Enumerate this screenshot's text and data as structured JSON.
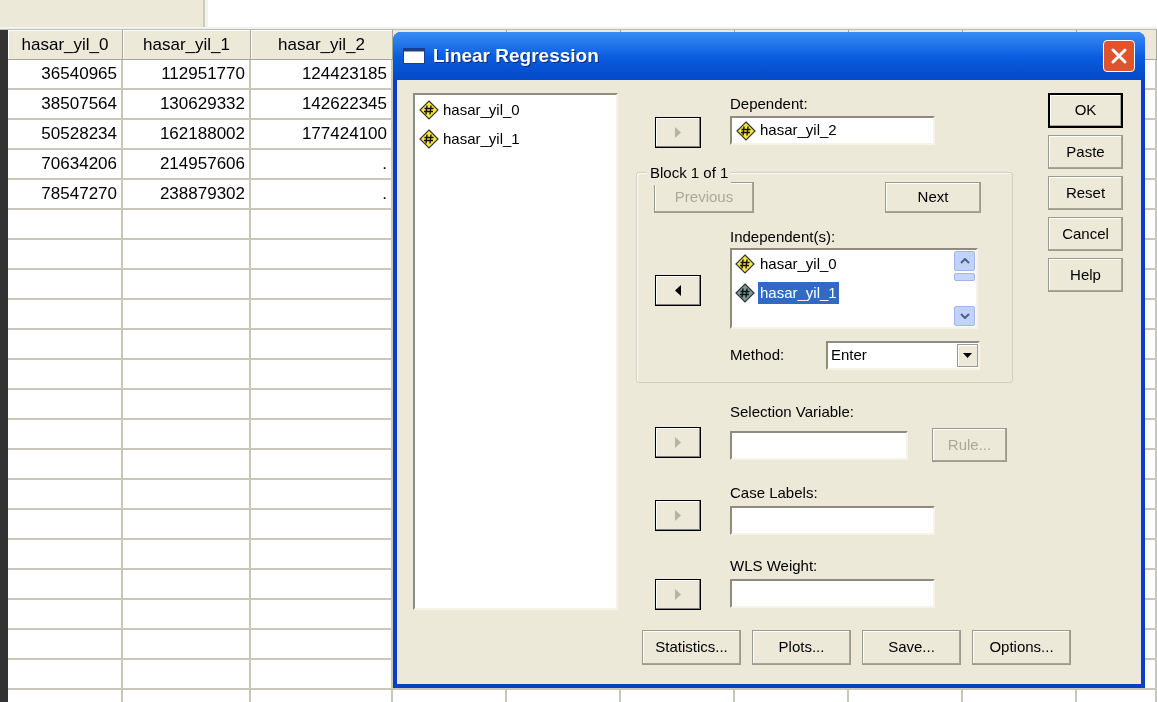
{
  "spreadsheet": {
    "columns": [
      "hasar_yil_0",
      "hasar_yil_1",
      "hasar_yil_2"
    ],
    "rows": [
      [
        "36540965",
        "112951770",
        "124423185"
      ],
      [
        "38507564",
        "130629332",
        "142622345"
      ],
      [
        "50528234",
        "162188002",
        "177424100"
      ],
      [
        "70634206",
        "214957606",
        "."
      ],
      [
        "78547270",
        "238879302",
        "."
      ]
    ]
  },
  "dialog": {
    "title": "Linear Regression",
    "source_variables": [
      {
        "name": "hasar_yil_0"
      },
      {
        "name": "hasar_yil_1"
      }
    ],
    "dependent": {
      "label": "Dependent:",
      "value": "hasar_yil_2",
      "arrow": {
        "kind": "add",
        "disabled": true
      }
    },
    "block": {
      "title": "Block 1 of 1",
      "previous": {
        "label": "Previous",
        "disabled": true
      },
      "next": {
        "label": "Next",
        "disabled": false
      },
      "arrow": {
        "kind": "remove",
        "disabled": false
      },
      "independents_label": "Independent(s):",
      "independents": [
        {
          "name": "hasar_yil_0",
          "selected": false
        },
        {
          "name": "hasar_yil_1",
          "selected": true
        }
      ],
      "method_label": "Method:",
      "method": "Enter"
    },
    "selection_variable": {
      "label": "Selection Variable:",
      "arrow": {
        "kind": "add",
        "disabled": true
      },
      "rule": {
        "label": "Rule...",
        "disabled": true
      }
    },
    "case_labels": {
      "label": "Case Labels:",
      "arrow": {
        "kind": "add",
        "disabled": true
      }
    },
    "wls_weight": {
      "label": "WLS Weight:",
      "arrow": {
        "kind": "add",
        "disabled": true
      }
    },
    "bottom_buttons": [
      {
        "label": "Statistics..."
      },
      {
        "label": "Plots..."
      },
      {
        "label": "Save..."
      },
      {
        "label": "Options..."
      }
    ],
    "side_buttons": [
      {
        "label": "OK",
        "default": true
      },
      {
        "label": "Paste",
        "default": false
      },
      {
        "label": "Reset",
        "default": false
      },
      {
        "label": "Cancel",
        "default": false
      },
      {
        "label": "Help",
        "default": false
      }
    ]
  }
}
